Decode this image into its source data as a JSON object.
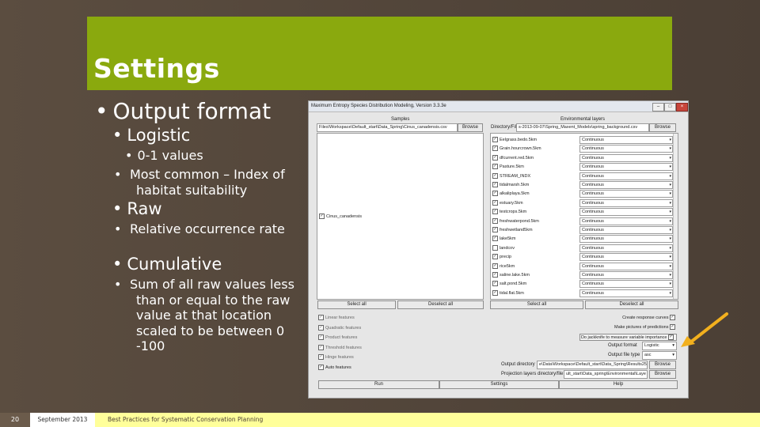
{
  "slide": {
    "title": "Settings",
    "bullets": {
      "output_format": "Output format",
      "logistic": "Logistic",
      "logistic_sub1": "0-1 values",
      "logistic_sub2": "Most common – Index of habitat suitability",
      "raw": "Raw",
      "raw_sub1": "Relative occurrence rate",
      "cumulative": "Cumulative",
      "cumulative_sub1": "Sum of all raw values less than or equal to the raw value at that location scaled to be between 0 -100"
    }
  },
  "footer": {
    "page_number": "20",
    "date": "September 2013",
    "course": "Best Practices for Systematic Conservation Planning"
  },
  "window": {
    "title": "Maximum Entropy Species Distribution Modeling, Version 3.3.3e",
    "samples_label": "Samples",
    "env_label": "Environmental layers",
    "samples_file": "Files\\Workspace\\Default_start\\Data_Spring\\Cinus_canadensis.csv",
    "env_dir_label": "Directory/File",
    "env_dir_value": "s-2013-09-07\\Spring_Maxent_Models\\spring_background.csv",
    "browse": "Browse",
    "species_item": "Cinus_canadensis",
    "select_all": "Select all",
    "deselect_all": "Deselect all",
    "layers": [
      {
        "name": "Eelgrass.bedo.5km",
        "type": "Continuous",
        "checked": true
      },
      {
        "name": "Grain.hourcrown.5km",
        "type": "Continuous",
        "checked": true
      },
      {
        "name": "dfcurrent.red.5km",
        "type": "Continuous",
        "checked": true
      },
      {
        "name": "Pasture.5km",
        "type": "Continuous",
        "checked": true
      },
      {
        "name": "STREAM_INDX",
        "type": "Continuous",
        "checked": true
      },
      {
        "name": "tidalmarsh.5km",
        "type": "Continuous",
        "checked": true
      },
      {
        "name": "alkaliplaya.5km",
        "type": "Continuous",
        "checked": true
      },
      {
        "name": "estuary.5km",
        "type": "Continuous",
        "checked": true
      },
      {
        "name": "testcrops.5km",
        "type": "Continuous",
        "checked": true
      },
      {
        "name": "freshwaterpond.5km",
        "type": "Continuous",
        "checked": true
      },
      {
        "name": "freshwetland5km",
        "type": "Continuous",
        "checked": true
      },
      {
        "name": "lake5km",
        "type": "Continuous",
        "checked": true
      },
      {
        "name": "landcov",
        "type": "Continuous",
        "checked": false
      },
      {
        "name": "precip",
        "type": "Continuous",
        "checked": true
      },
      {
        "name": "rice5km",
        "type": "Continuous",
        "checked": true
      },
      {
        "name": "saline.lake.5km",
        "type": "Continuous",
        "checked": true
      },
      {
        "name": "salt.pond.5km",
        "type": "Continuous",
        "checked": true
      },
      {
        "name": "tidal.flat.5km",
        "type": "Continuous",
        "checked": true
      }
    ],
    "features": [
      {
        "label": "Linear features",
        "checked": true
      },
      {
        "label": "Quadratic features",
        "checked": true
      },
      {
        "label": "Product features",
        "checked": true
      },
      {
        "label": "Threshold features",
        "checked": true
      },
      {
        "label": "Hinge features",
        "checked": true
      },
      {
        "label": "Auto features",
        "checked": true
      }
    ],
    "options": {
      "response_curves": "Create response curves",
      "pictures": "Make pictures of predictions",
      "jackknife": "Do jackknife to measure variable importance",
      "output_format_label": "Output format",
      "output_format_value": "Logistic",
      "output_file_type_label": "Output file type",
      "output_file_type_value": "asc",
      "output_dir_label": "Output directory",
      "output_dir_value": "e\\Data\\Workspace\\Default_start\\Data_Spring\\Results25",
      "proj_dir_label": "Projection layers directory/file",
      "proj_dir_value": "ult_start\\Data_spring\\Environmental\\Laye"
    },
    "bottom_buttons": {
      "run": "Run",
      "settings": "Settings",
      "help": "Help"
    }
  },
  "colors": {
    "title_bar": "#8aa90e",
    "background": "#5b4d40",
    "footer": "#ffff9a",
    "arrow": "#f2b01e"
  }
}
